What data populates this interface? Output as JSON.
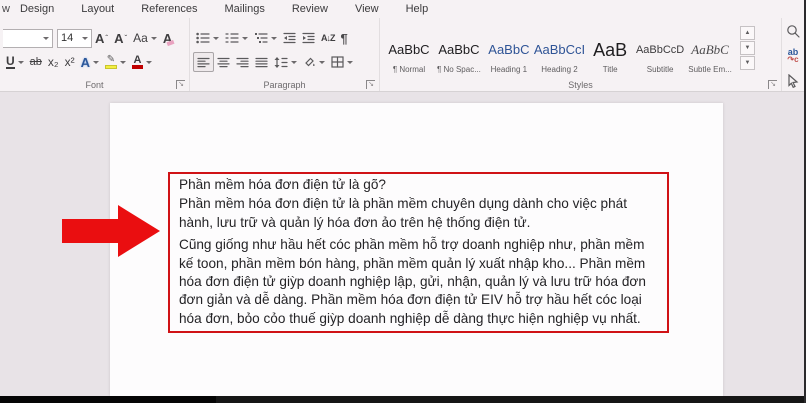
{
  "colors": {
    "accent_red": "#d01216",
    "arrow_red": "#ea0e10",
    "heading_blue": "#2f5496"
  },
  "menu": {
    "partial_tab": "w",
    "tabs": [
      "Design",
      "Layout",
      "References",
      "Mailings",
      "Review",
      "View",
      "Help"
    ]
  },
  "ribbon": {
    "font_group": {
      "label": "Font",
      "font_size_value": "14",
      "glyphs": {
        "grow_font": "A",
        "shrink_font": "A",
        "change_case": "Aa",
        "clear_format": "A",
        "underline": "U",
        "strikethrough": "ab",
        "subscript": "x₂",
        "superscript": "x²",
        "text_effects": "A",
        "highlight_pen": "✎",
        "font_color": "A"
      }
    },
    "paragraph_group": {
      "label": "Paragraph",
      "glyphs": {
        "sort": "A↓Z",
        "pilcrow": "¶"
      }
    },
    "styles_group": {
      "label": "Styles",
      "items": [
        {
          "preview": "AaBbC",
          "name": "¶ Normal"
        },
        {
          "preview": "AaBbC",
          "name": "¶ No Spac..."
        },
        {
          "preview": "AaBbC",
          "name": "Heading 1"
        },
        {
          "preview": "AaBbCcI",
          "name": "Heading 2"
        },
        {
          "preview": "AaB",
          "name": "Title"
        },
        {
          "preview": "AaBbCcD",
          "name": "Subtitle"
        },
        {
          "preview": "AaBbC",
          "name": "Subtle Em..."
        }
      ]
    }
  },
  "document": {
    "paragraphs": [
      "Phần mềm hóa đơn điện tử là gõ?",
      "Phần mềm hóa đơn điện tử là phần mềm chuyên dụng dành cho việc phát hành, lưu trữ và quản lý hóa đơn ảo trên hệ thống điện tử.",
      "Cũng giống như hầu hết cóc phần mềm hỗ trợ doanh nghiệp như, phần mềm kế toon, phần mềm bón hàng, phần mềm quản lý xuất nhập kho... Phần mềm hóa đơn điện tử giỳp doanh nghiệp lập, gửi, nhận, quản lý và lưu trữ hóa đơn đơn giản và dễ dàng. Phần mềm hóa đơn điện tử EIV hỗ trợ hầu hết cóc loại hóa đơn, bỏo cỏo thuế giỳp doanh nghiệp dễ dàng thực hiện nghiệp vụ nhất."
    ]
  }
}
